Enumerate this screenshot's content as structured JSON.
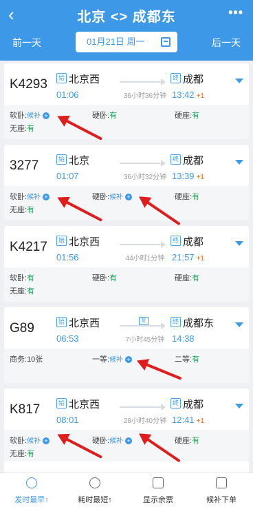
{
  "header": {
    "back_icon": "chevron-left-icon",
    "title": "北京 <> 成都东",
    "more_icon": "more-dots-icon",
    "prev_day": "前一天",
    "next_day": "后一天",
    "date": "01月21日 周一",
    "calendar_icon": "calendar-icon"
  },
  "labels": {
    "start": "始",
    "end": "终",
    "fuxing": "复"
  },
  "trains": [
    {
      "number": "K4293",
      "from": "北京西",
      "to": "成都",
      "dep": "01:06",
      "arr": "13:42",
      "plus": "+1",
      "duration": "36小时36分钟",
      "seats_row1": [
        {
          "label": "软卧:",
          "status": "候补",
          "waitlist": true
        },
        {
          "label": "硬卧:",
          "status": "有",
          "waitlist": false
        },
        {
          "label": "硬座:",
          "status": "有",
          "waitlist": false
        }
      ],
      "seats_row2": [
        {
          "label": "无座:",
          "status": "有",
          "waitlist": false
        }
      ]
    },
    {
      "number": "3277",
      "from": "北京",
      "to": "成都",
      "dep": "01:07",
      "arr": "13:39",
      "plus": "+1",
      "duration": "36小时32分钟",
      "seats_row1": [
        {
          "label": "软卧:",
          "status": "候补",
          "waitlist": true
        },
        {
          "label": "硬卧:",
          "status": "候补",
          "waitlist": true
        },
        {
          "label": "硬座:",
          "status": "有",
          "waitlist": false
        }
      ],
      "seats_row2": [
        {
          "label": "无座:",
          "status": "有",
          "waitlist": false
        }
      ]
    },
    {
      "number": "K4217",
      "from": "北京西",
      "to": "成都",
      "dep": "01:56",
      "arr": "21:57",
      "plus": "+1",
      "duration": "44小时1分钟",
      "seats_row1": [
        {
          "label": "软卧:",
          "status": "有",
          "waitlist": false
        },
        {
          "label": "硬卧:",
          "status": "有",
          "waitlist": false
        },
        {
          "label": "硬座:",
          "status": "有",
          "waitlist": false
        }
      ],
      "seats_row2": [
        {
          "label": "无座:",
          "status": "有",
          "waitlist": false
        }
      ]
    },
    {
      "number": "G89",
      "from": "北京西",
      "to": "成都东",
      "dep": "06:53",
      "arr": "14:38",
      "plus": "",
      "duration": "7小时45分钟",
      "fuxing": true,
      "seats_row1": [
        {
          "label": "商务:",
          "status": "10张",
          "waitlist": false,
          "plain": true
        },
        {
          "label": "一等:",
          "status": "候补",
          "waitlist": true
        },
        {
          "label": "二等:",
          "status": "有",
          "waitlist": false
        }
      ],
      "seats_row2": []
    },
    {
      "number": "K817",
      "from": "北京西",
      "to": "成都",
      "dep": "08:01",
      "arr": "12:41",
      "plus": "+1",
      "duration": "28小时40分钟",
      "seats_row1": [
        {
          "label": "软卧:",
          "status": "候补",
          "waitlist": true
        },
        {
          "label": "硬卧:",
          "status": "候补",
          "waitlist": true
        },
        {
          "label": "硬座:",
          "status": "有",
          "waitlist": false
        }
      ],
      "seats_row2": [
        {
          "label": "无座:",
          "status": "有",
          "waitlist": false
        }
      ]
    }
  ],
  "bottom_tabs": [
    {
      "label": "发时最早↑",
      "icon": "clock-24-icon",
      "active": true
    },
    {
      "label": "耗时最短↑",
      "icon": "timer-icon",
      "active": false
    },
    {
      "label": "显示余票",
      "icon": "ticket-tag-icon",
      "active": false
    },
    {
      "label": "候补下单",
      "icon": "cart-icon",
      "active": false
    }
  ],
  "colors": {
    "primary": "#3d99e8",
    "available": "#1fa85a",
    "overnight": "#e06a1a",
    "annotation": "#e01c1c"
  }
}
